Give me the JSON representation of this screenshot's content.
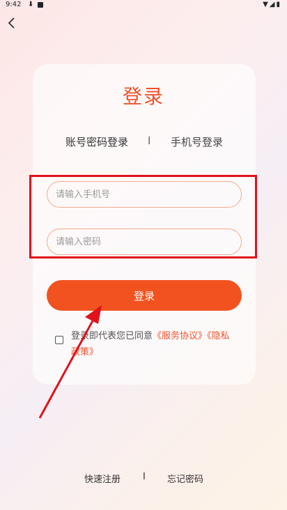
{
  "status": {
    "time": "9:42"
  },
  "page": {
    "title": "登录",
    "tabs": {
      "password_login": "账号密码登录",
      "separator": "I",
      "phone_login": "手机号登录"
    },
    "phone_placeholder": "请输入手机号",
    "password_placeholder": "请输入密码",
    "login_button": "登录",
    "agreement": {
      "prefix": "登录即代表您已同意",
      "service_link": "《服务协议》",
      "privacy_link": "《隐私政策》"
    }
  },
  "footer": {
    "register": "快速注册",
    "separator": "I",
    "forgot": "忘记密码"
  },
  "colors": {
    "accent": "#f2521f",
    "highlight": "#e0121b"
  }
}
